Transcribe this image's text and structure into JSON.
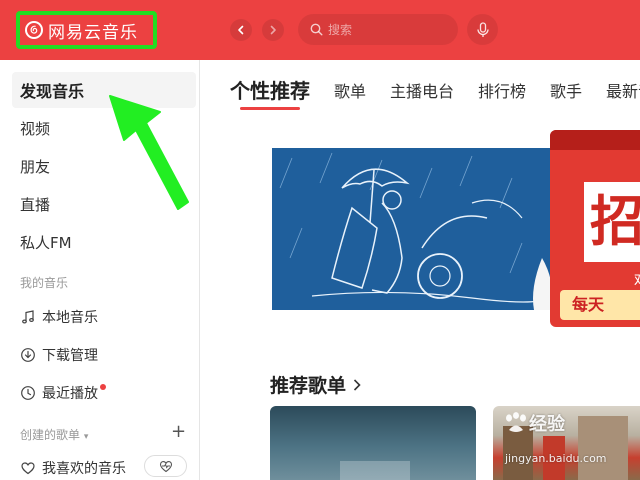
{
  "app": {
    "name": "网易云音乐",
    "accent": "#ec4141"
  },
  "header": {
    "search_placeholder": "搜索",
    "back_icon": "chevron-left-icon",
    "forward_icon": "chevron-right-icon",
    "mic_icon": "microphone-icon"
  },
  "sidebar": {
    "main_items": [
      {
        "label": "发现音乐",
        "active": true
      },
      {
        "label": "视频"
      },
      {
        "label": "朋友"
      },
      {
        "label": "直播"
      },
      {
        "label": "私人FM"
      }
    ],
    "my_music_title": "我的音乐",
    "my_music_items": [
      {
        "label": "本地音乐",
        "icon": "music-note-icon"
      },
      {
        "label": "下载管理",
        "icon": "download-icon"
      },
      {
        "label": "最近播放",
        "icon": "clock-icon",
        "badge": "red-dot"
      }
    ],
    "created_title": "创建的歌单",
    "liked_label": "我喜欢的音乐"
  },
  "tabs": [
    {
      "label": "个性推荐",
      "active": true
    },
    {
      "label": "歌单"
    },
    {
      "label": "主播电台"
    },
    {
      "label": "排行榜"
    },
    {
      "label": "歌手"
    },
    {
      "label": "最新音乐"
    }
  ],
  "banner2": {
    "big_char": "招",
    "sub": "戏",
    "bottom": "每天"
  },
  "recommended": {
    "title": "推荐歌单"
  },
  "watermark": {
    "text": "经验",
    "sub": "jingyan.baidu.com"
  }
}
